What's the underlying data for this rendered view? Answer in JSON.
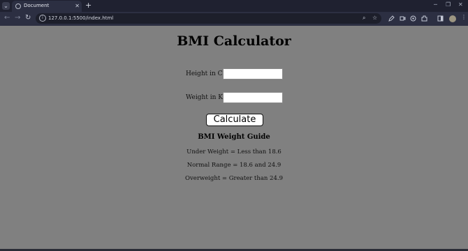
{
  "browser": {
    "tab_search_glyph": "⌄",
    "tab_title": "Document",
    "tab_close": "✕",
    "new_tab": "+",
    "win_minimize": "─",
    "win_restore": "❐",
    "win_close": "✕",
    "back_glyph": "←",
    "forward_glyph": "→",
    "reload_glyph": "↻",
    "site_info_glyph": "i",
    "url": "127.0.0.1:5500/index.html",
    "zoom_glyph": "⌕",
    "bookmark_glyph": "☆",
    "menu_glyph": "⋮",
    "icons": [
      "tab-search-icon",
      "favicon-icon",
      "back-icon",
      "forward-icon",
      "reload-icon",
      "site-info-icon",
      "zoom-icon",
      "bookmark-star-icon",
      "edit-icon",
      "extension-icon",
      "sidebar-icon",
      "avatar",
      "menu-icon"
    ]
  },
  "page": {
    "title": "BMI Calculator",
    "height_label": "Height in CM:",
    "height_value": "",
    "weight_label": "Weight in KG:",
    "weight_value": "",
    "calculate_label": "Calculate",
    "guide_title": "BMI Weight Guide",
    "guide": [
      "Under Weight = Less than 18.6",
      "Normal Range = 18.6 and 24.9",
      "Overweight = Greater than 24.9"
    ]
  },
  "colors": {
    "page_background": "#808080",
    "chrome_dark": "#1f2130",
    "toolbar": "#2c2f42"
  }
}
